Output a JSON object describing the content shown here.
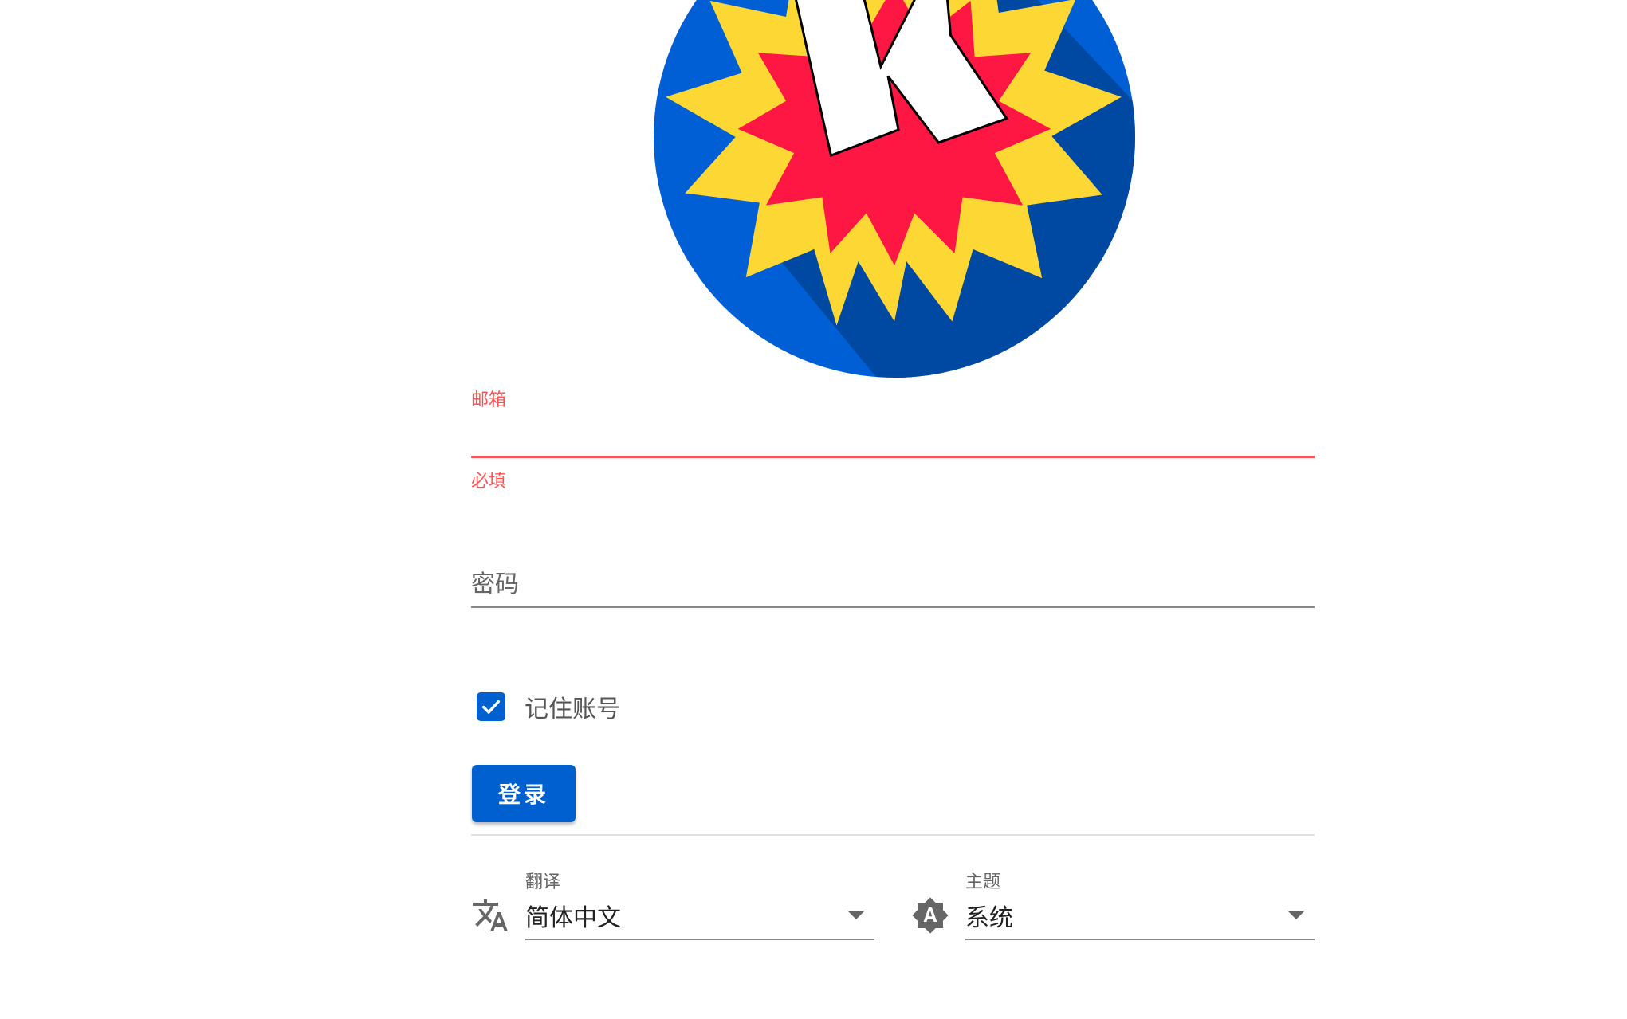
{
  "colors": {
    "primary": "#0060d0",
    "error": "#ff5252",
    "logo_circle": "#005fd4",
    "logo_shadow": "#0049a3",
    "star_outer": "#fdd835",
    "star_inner": "#ff1744"
  },
  "form": {
    "email": {
      "label": "邮箱",
      "error": "必填",
      "value": ""
    },
    "password": {
      "label": "密码",
      "value": ""
    },
    "remember": {
      "label": "记住账号",
      "checked": true
    },
    "login_button": "登录"
  },
  "settings": {
    "language": {
      "icon": "translate-icon",
      "label": "翻译",
      "value": "简体中文"
    },
    "theme": {
      "icon": "brightness-auto-icon",
      "label": "主题",
      "value": "系统"
    }
  }
}
